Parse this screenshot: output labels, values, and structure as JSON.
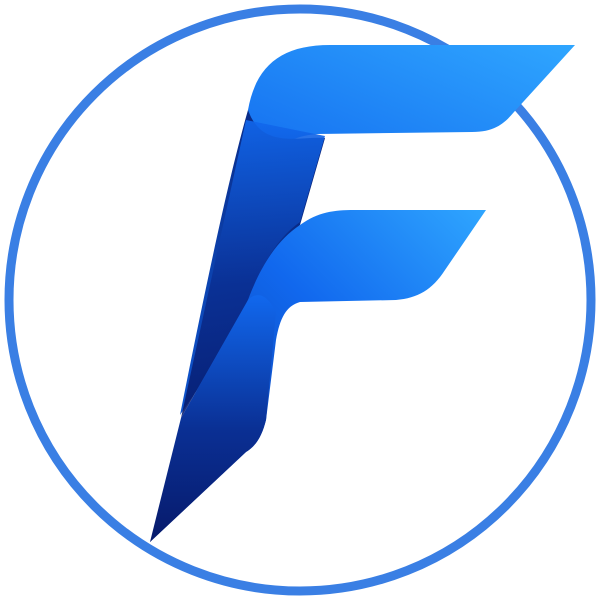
{
  "logo": {
    "icon": "letter-f-logo-icon",
    "colors": {
      "ring": "#3a7fe4",
      "background": "#ffffff",
      "highlight": "#2fa6ff",
      "primary": "#1168ee",
      "deep": "#0a2f93",
      "navy": "#071a6b"
    }
  }
}
